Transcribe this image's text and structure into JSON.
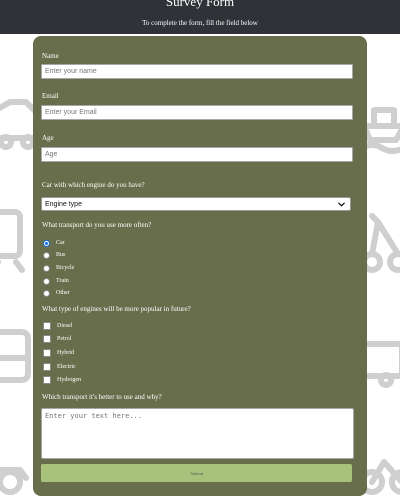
{
  "header": {
    "title": "Survey Form",
    "subtitle": "To complete the form, fill the field below"
  },
  "fields": {
    "name": {
      "label": "Name",
      "placeholder": "Enter your name"
    },
    "email": {
      "label": "Email",
      "placeholder": "Enter your Email"
    },
    "age": {
      "label": "Age",
      "placeholder": "Age"
    }
  },
  "engine": {
    "label": "Car with which engine do you have?",
    "selected": "Engine type"
  },
  "transport": {
    "label": "What transport do you use more often?",
    "options": [
      {
        "label": "Car",
        "selected": true
      },
      {
        "label": "Bus",
        "selected": false
      },
      {
        "label": "Bicycle",
        "selected": false
      },
      {
        "label": "Train",
        "selected": false
      },
      {
        "label": "Other",
        "selected": false
      }
    ]
  },
  "future_engines": {
    "label": "What type of engines will be more popular in future?",
    "options": [
      {
        "label": "Diesel",
        "checked": false
      },
      {
        "label": "Petrol",
        "checked": false
      },
      {
        "label": "Hybrid",
        "checked": false
      },
      {
        "label": "Electric",
        "checked": false
      },
      {
        "label": "Hydrogen",
        "checked": false
      }
    ]
  },
  "comment": {
    "label": "Which transport it's better to use and why?",
    "placeholder": "Enter your text here..."
  },
  "submit_label": "Submit",
  "colors": {
    "header_bg": "#2f3338",
    "form_bg": "#686e4c",
    "submit_bg": "#a9c27b",
    "radio_accent": "#1a6ad8",
    "pattern_stroke": "#cfcfcf"
  },
  "icons": {
    "select": "chevron-down-icon",
    "background": [
      "car-icon",
      "bicycle-icon",
      "bus-icon",
      "ship-icon",
      "train-icon",
      "scooter-icon",
      "plane-icon",
      "taxi-icon",
      "motorcycle-icon",
      "camper-van-icon"
    ]
  }
}
